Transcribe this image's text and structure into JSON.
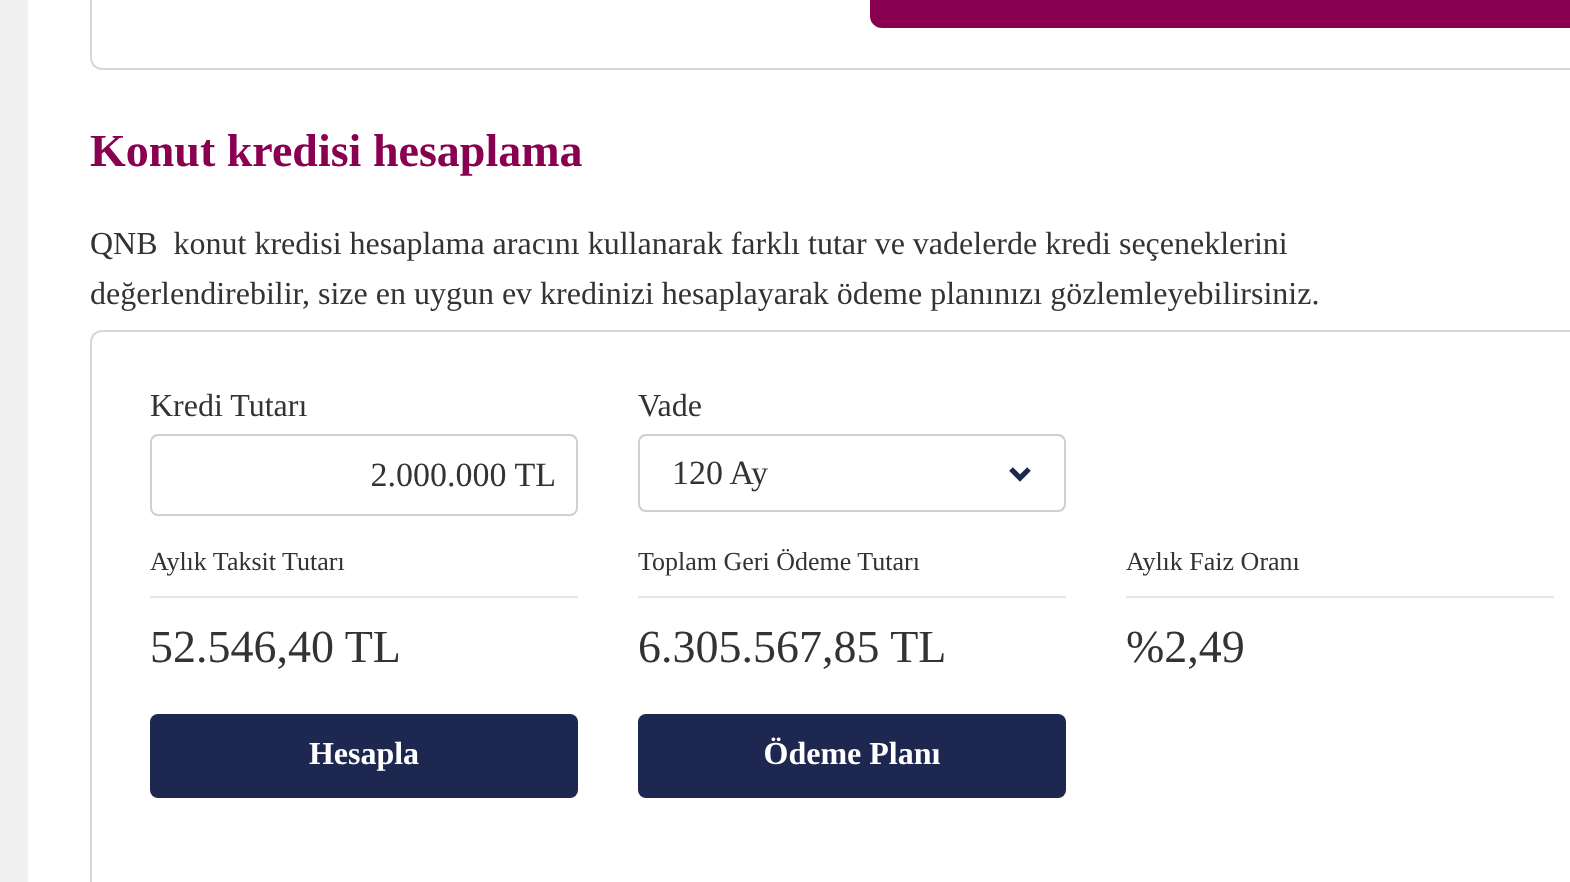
{
  "section": {
    "title": "Konut kredisi hesaplama",
    "description": "QNB  konut kredisi hesaplama aracını kullanarak farklı tutar ve vadelerde kredi seçeneklerini değerlendirebilir, size en uygun ev kredinizi hesaplayarak ödeme planınızı gözlemleyebilirsiniz."
  },
  "calculator": {
    "amount": {
      "label": "Kredi Tutarı",
      "value": "2.000.000 TL"
    },
    "term": {
      "label": "Vade",
      "value": "120 Ay"
    },
    "results": [
      {
        "label": "Aylık Taksit Tutarı",
        "value": "52.546,40 TL"
      },
      {
        "label": "Toplam Geri Ödeme Tutarı",
        "value": "6.305.567,85 TL"
      },
      {
        "label": "Aylık Faiz Oranı",
        "value": "%2,49"
      }
    ],
    "buttons": [
      "Hesapla",
      "Ödeme Planı"
    ]
  }
}
